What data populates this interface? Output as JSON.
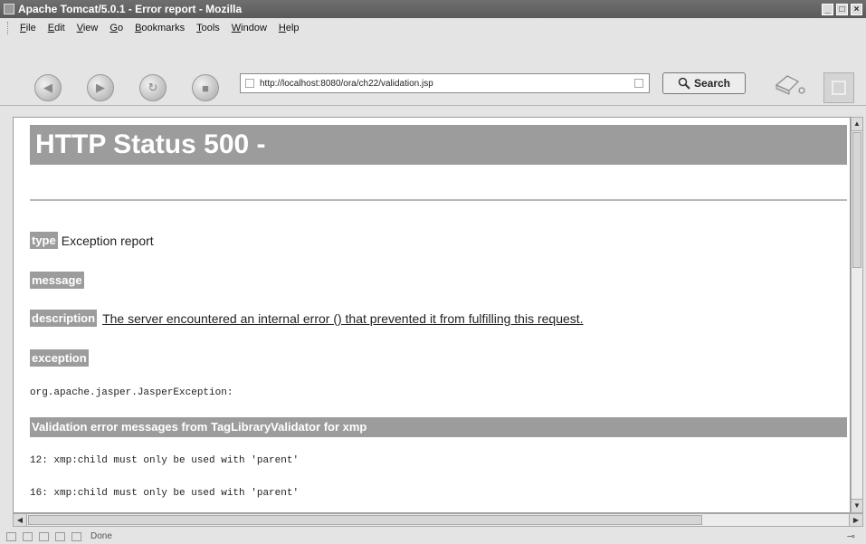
{
  "window": {
    "title": "Apache Tomcat/5.0.1 - Error report - Mozilla",
    "controls": [
      "_",
      "□",
      "×"
    ]
  },
  "menu": [
    "File",
    "Edit",
    "View",
    "Go",
    "Bookmarks",
    "Tools",
    "Window",
    "Help"
  ],
  "toolbar": {
    "url": "http://localhost:8080/ora/ch22/validation.jsp",
    "search_label": "Search",
    "icons": [
      "back-icon",
      "forward-icon",
      "reload-icon",
      "stop-icon",
      "search-icon",
      "print-icon"
    ]
  },
  "page": {
    "heading": "HTTP Status 500 -",
    "type_label": "type",
    "type_value": "Exception report",
    "message_label": "message",
    "description_label": "description",
    "description_value": "The server encountered an internal error () that prevented it from fulfilling this request.",
    "exception_label": "exception",
    "exception_value": "org.apache.jasper.JasperException:",
    "validation_header": "Validation error messages from TagLibraryValidator for xmp",
    "errors": [
      "12: xmp:child must only be used with 'parent'",
      "16: xmp:child must only be used with 'parent'"
    ]
  },
  "statusbar": {
    "text": "Done"
  }
}
